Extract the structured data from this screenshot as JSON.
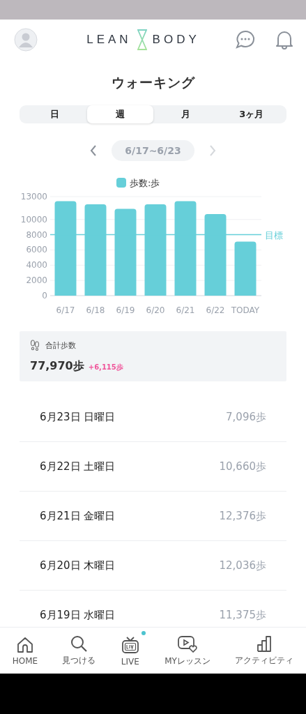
{
  "header": {
    "logo_left": "LEAN",
    "logo_right": "BODY"
  },
  "title": "ウォーキング",
  "tabs": [
    {
      "label": "日",
      "selected": false
    },
    {
      "label": "週",
      "selected": true
    },
    {
      "label": "月",
      "selected": false
    },
    {
      "label": "3ヶ月",
      "selected": false
    }
  ],
  "date_nav": {
    "range": "6/17~6/23",
    "next_disabled": true
  },
  "chart_data": {
    "type": "bar",
    "series": [
      {
        "name": "歩数:歩",
        "color": "#66cfd9",
        "values": [
          12400,
          12000,
          11400,
          12000,
          12400,
          10700,
          7100
        ]
      }
    ],
    "categories": [
      "6/17",
      "6/18",
      "6/19",
      "6/20",
      "6/21",
      "6/22",
      "TODAY"
    ],
    "ylim": [
      0,
      13000
    ],
    "yticks": [
      0,
      2000,
      4000,
      6000,
      8000,
      10000,
      13000
    ],
    "grid": true,
    "ref_lines": [
      {
        "axis": "y",
        "value": 8000,
        "label": "目標"
      }
    ]
  },
  "summary": {
    "label": "合計歩数",
    "total": "77,970歩",
    "change": "+6,115歩"
  },
  "days": [
    {
      "date": "6月23日 日曜日",
      "steps": "7,096歩"
    },
    {
      "date": "6月22日 土曜日",
      "steps": "10,660歩"
    },
    {
      "date": "6月21日 金曜日",
      "steps": "12,376歩"
    },
    {
      "date": "6月20日 木曜日",
      "steps": "12,036歩"
    },
    {
      "date": "6月19日 水曜日",
      "steps": "11,375歩"
    }
  ],
  "bottom_nav": [
    {
      "label": "HOME",
      "badge": false
    },
    {
      "label": "見つける",
      "badge": false
    },
    {
      "label": "LIVE",
      "badge": true
    },
    {
      "label": "MYレッスン",
      "badge": false
    },
    {
      "label": "アクティビティ",
      "badge": false
    }
  ]
}
